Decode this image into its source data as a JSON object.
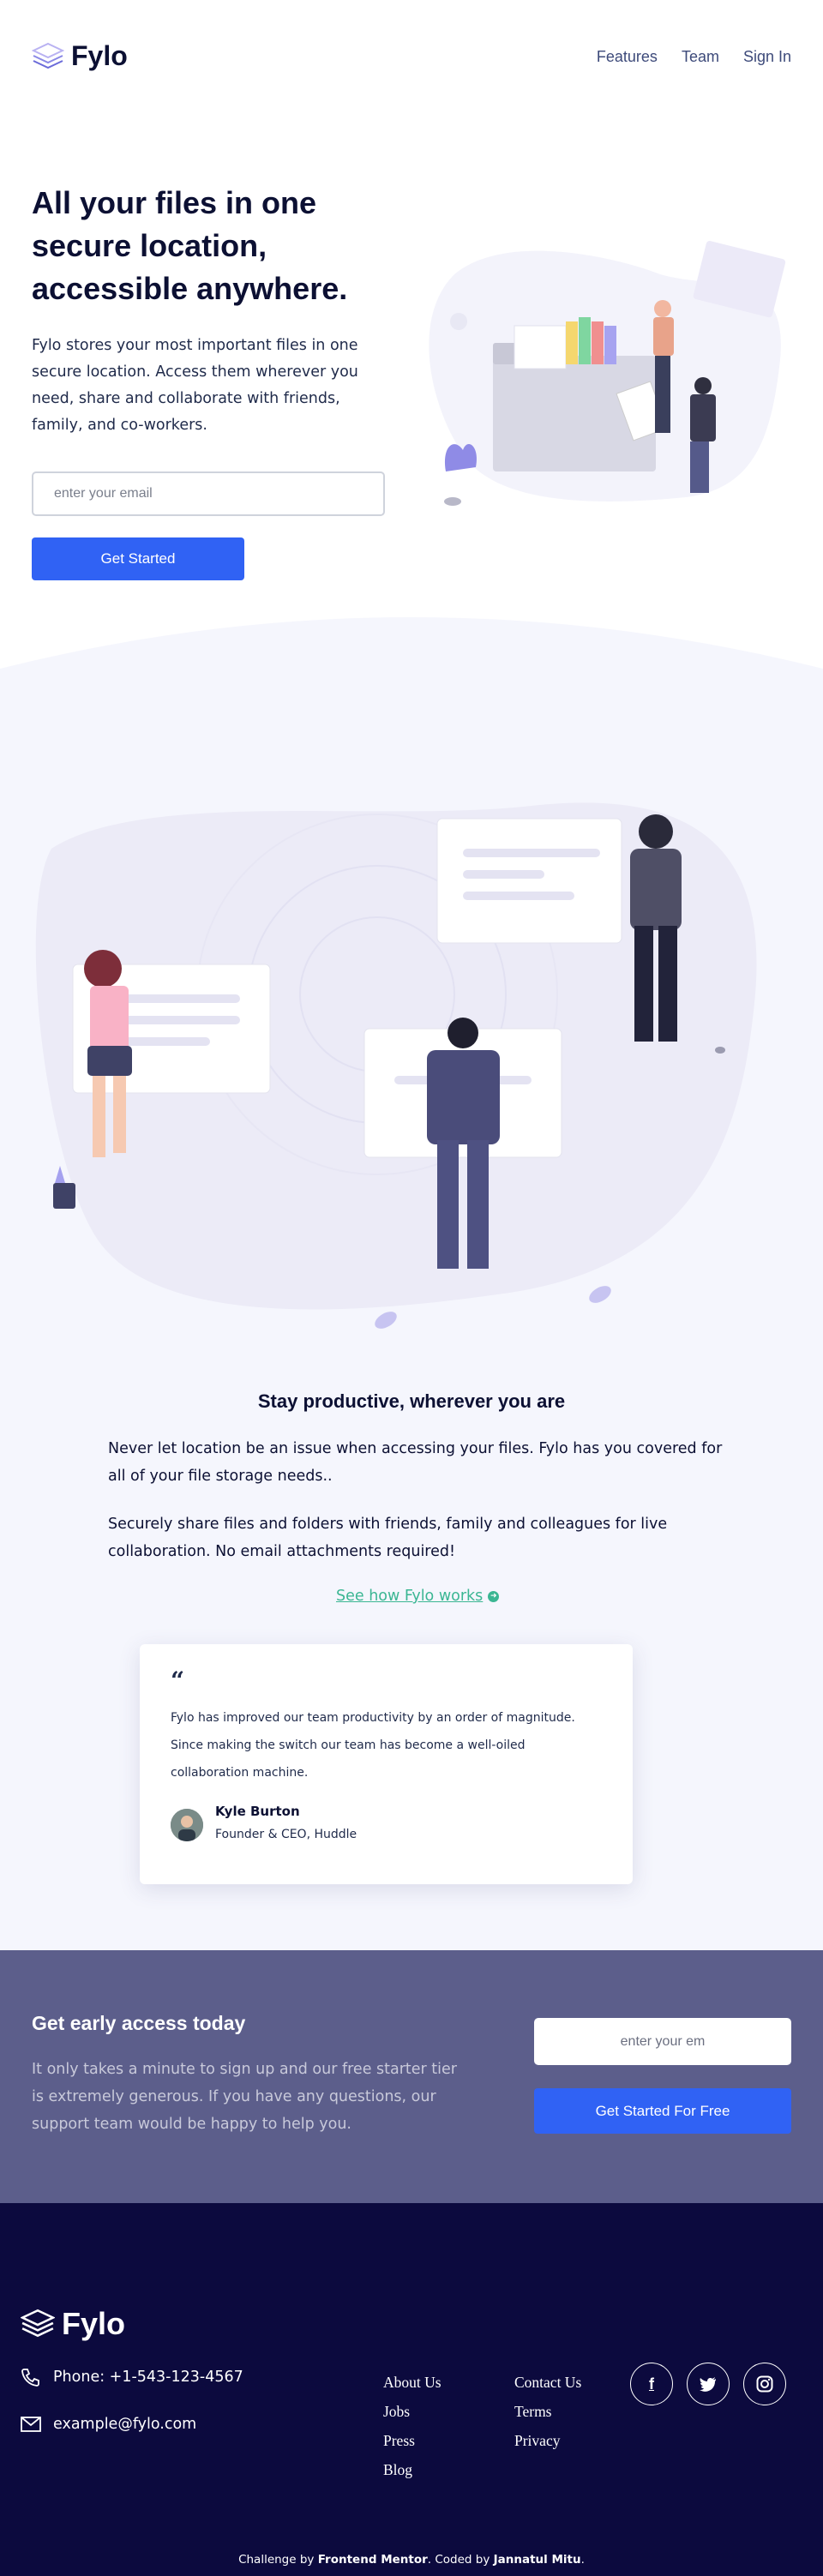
{
  "header": {
    "logo_text": "Fylo",
    "nav": [
      {
        "label": "Features"
      },
      {
        "label": "Team"
      },
      {
        "label": "Sign In"
      }
    ]
  },
  "hero": {
    "title": "All your files in one secure location, accessible anywhere.",
    "description": "Fylo stores your most important files in one secure location. Access them wherever you need, share and collaborate with friends, family, and co-workers.",
    "email_placeholder": "enter your email",
    "button_label": "Get Started"
  },
  "productive": {
    "title": "Stay productive, wherever you are",
    "paragraph_1": "Never let location be an issue when accessing your files. Fylo has you covered for all of your file storage needs..",
    "paragraph_2": "Securely share files and folders with friends, family and colleagues for live collaboration. No email attachments required!",
    "link_label": "See how Fylo works"
  },
  "testimonial": {
    "quote_mark": "“",
    "text": "Fylo has improved our team productivity by an order of magnitude. Since making the switch our team has become a well-oiled collaboration machine.",
    "name": "Kyle Burton",
    "role": "Founder & CEO, Huddle"
  },
  "early_access": {
    "title": "Get early access today",
    "description": "It only takes a minute to sign up and our free starter tier is extremely generous. If you have any questions, our support team would be happy to help you.",
    "email_placeholder": "enter your em",
    "button_label": "Get Started For Free"
  },
  "footer": {
    "logo_text": "Fylo",
    "phone": "Phone: +1-543-123-4567",
    "email": "example@fylo.com",
    "links_col1": [
      "About Us",
      "Jobs",
      "Press",
      "Blog"
    ],
    "links_col2": [
      "Contact Us",
      "Terms",
      "Privacy"
    ],
    "socials": [
      {
        "icon": "facebook-icon",
        "glyph": "f"
      },
      {
        "icon": "twitter-icon",
        "glyph": "t"
      },
      {
        "icon": "instagram-icon",
        "glyph": "◎"
      }
    ],
    "attribution_prefix": "Challenge by ",
    "attribution_org": "Frontend Mentor",
    "attribution_mid": ". Coded by ",
    "attribution_author": "Jannatul Mitu",
    "attribution_suffix": "."
  },
  "colors": {
    "accent": "#3062f4",
    "link_green": "#3bb693",
    "early_bg": "#5c5e8b",
    "footer_bg": "#0c0a3e",
    "section_bg": "#f5f6fd"
  }
}
